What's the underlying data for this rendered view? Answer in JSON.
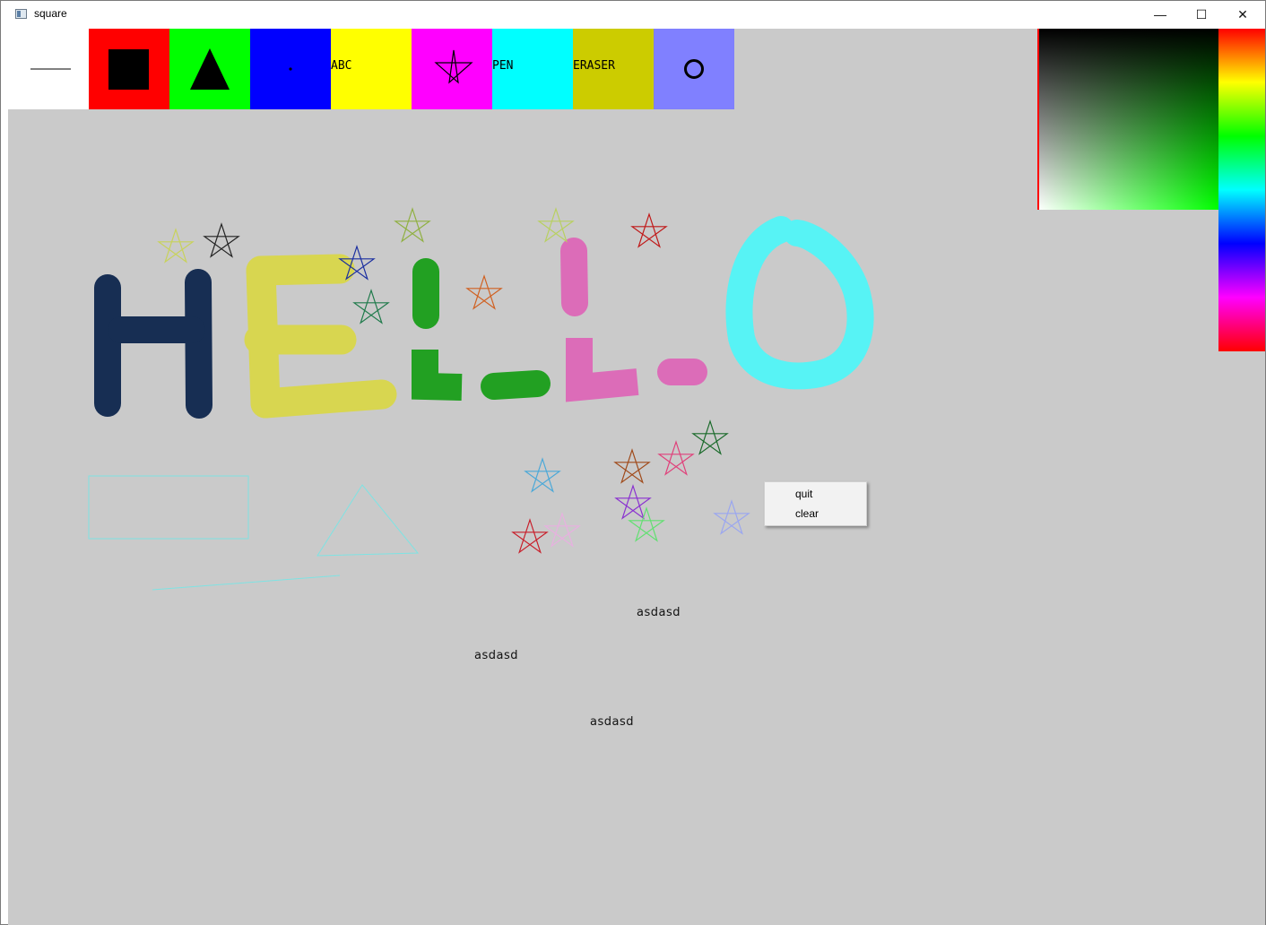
{
  "window": {
    "title": "square",
    "minimize_glyph": "—",
    "maximize_glyph": "☐",
    "close_glyph": "✕"
  },
  "toolbar": {
    "tools": [
      {
        "name": "line",
        "bg": "#ffffff",
        "icon": "line-icon",
        "label": ""
      },
      {
        "name": "rectangle",
        "bg": "#ff0000",
        "icon": "square-icon",
        "label": ""
      },
      {
        "name": "triangle",
        "bg": "#00ff00",
        "icon": "triangle-icon",
        "label": ""
      },
      {
        "name": "point",
        "bg": "#0000ff",
        "icon": "dot-icon",
        "label": ""
      },
      {
        "name": "text",
        "bg": "#ffff00",
        "icon": "",
        "label": "ABC"
      },
      {
        "name": "star",
        "bg": "#ff00ff",
        "icon": "star-icon",
        "label": ""
      },
      {
        "name": "pen",
        "bg": "#00ffff",
        "icon": "",
        "label": "PEN"
      },
      {
        "name": "eraser",
        "bg": "#cccc00",
        "icon": "",
        "label": "ERASER"
      },
      {
        "name": "circle",
        "bg": "#8080ff",
        "icon": "circle-icon",
        "label": ""
      }
    ]
  },
  "color_picker": {
    "current_hue": "#00ff00",
    "hue_bar": "vertical-rainbow"
  },
  "canvas": {
    "background": "#cacaca",
    "texts": [
      "asdasd",
      "asdasd",
      "asdasd"
    ]
  },
  "context_menu": {
    "items": [
      "quit",
      "clear"
    ]
  }
}
